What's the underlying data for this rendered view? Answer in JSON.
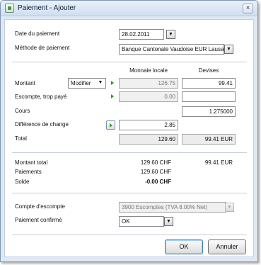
{
  "window": {
    "title": "Paiement - Ajouter",
    "close_glyph": "×"
  },
  "payment": {
    "date_label": "Date du paiement",
    "date_value": "28.02.2011",
    "method_label": "Méthode de paiement",
    "method_value": "Banque Cantonale Vaudoise EUR Lausa"
  },
  "columns": {
    "local": "Monnaie locale",
    "foreign": "Devises"
  },
  "amounts": {
    "montant_label": "Montant",
    "modifier_label": "Modifier",
    "montant_local": "126.75",
    "montant_foreign": "99.41",
    "escompte_label": "Escompte, trop payé",
    "escompte_local": "0.00",
    "escompte_foreign": "",
    "cours_label": "Cours",
    "cours_value": "1.275000",
    "diff_label": "Différence de change",
    "diff_value": "2.85",
    "total_label": "Total",
    "total_local": "129.60",
    "total_foreign": "99.41 EUR"
  },
  "summary": {
    "montant_total_label": "Montant total",
    "montant_total_local": "129.60 CHF",
    "montant_total_foreign": "99.41 EUR",
    "paiements_label": "Paiements",
    "paiements_local": "129.60 CHF",
    "solde_label": "Solde",
    "solde_local": "-0.00 CHF"
  },
  "options": {
    "compte_label": "Compte d'escompte",
    "compte_value": "3900 Escomptes (TVA 8.00% Net)",
    "confirme_label": "Paiement confirmé",
    "confirme_value": "OK"
  },
  "buttons": {
    "ok": "OK",
    "cancel": "Annuler"
  },
  "icons": {
    "dropdown": "▼"
  }
}
